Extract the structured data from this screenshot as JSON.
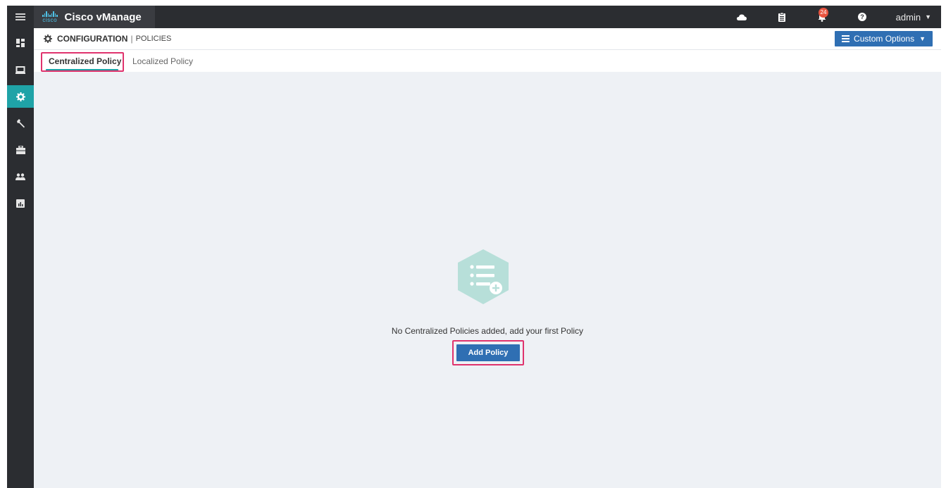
{
  "app": {
    "title": "Cisco vManage",
    "logo_word": "cisco",
    "user": "admin",
    "notification_count": "24"
  },
  "header": {
    "section": "CONFIGURATION",
    "separator": "|",
    "page": "POLICIES",
    "custom_options_label": "Custom Options"
  },
  "tabs": [
    {
      "label": "Centralized Policy",
      "active": true
    },
    {
      "label": "Localized Policy",
      "active": false
    }
  ],
  "empty_state": {
    "message": "No Centralized Policies added, add your first Policy",
    "button_label": "Add Policy"
  },
  "rail_icons": [
    "menu-icon",
    "dashboard-icon",
    "monitor-icon",
    "configuration-icon",
    "tools-icon",
    "maintenance-icon",
    "administration-icon",
    "analytics-icon"
  ],
  "top_icons": [
    "cloud-icon",
    "task-list-icon",
    "bell-icon",
    "help-icon"
  ],
  "colors": {
    "rail_bg": "#2b2d31",
    "accent_teal": "#1fa3a7",
    "primary_blue": "#2f6fb3",
    "highlight_pink": "#e0336d",
    "content_bg": "#eef1f5",
    "hexagon_fill": "#b7dfd9"
  }
}
